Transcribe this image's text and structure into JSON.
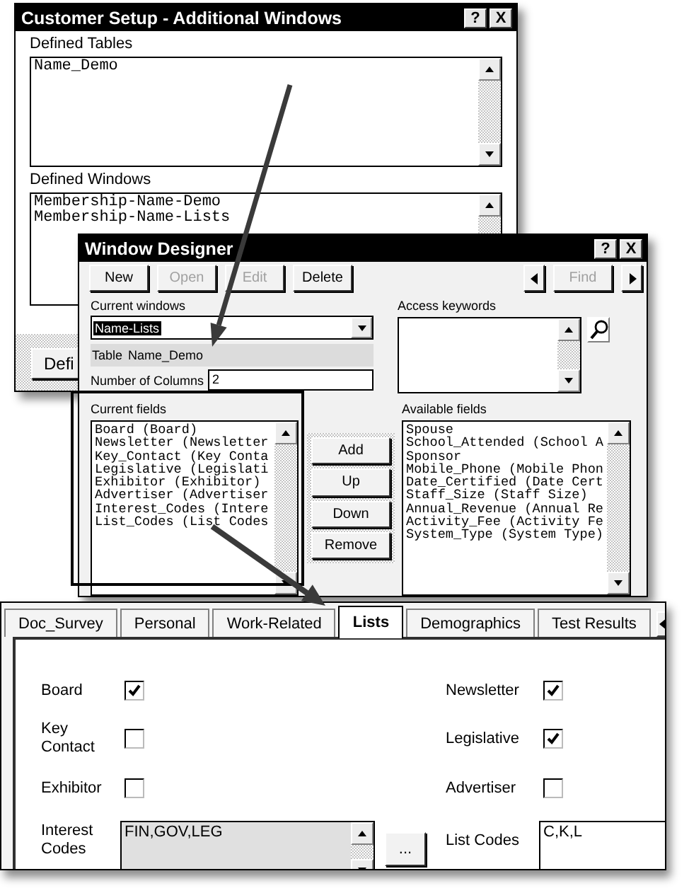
{
  "setup_window": {
    "title": "Customer Setup - Additional Windows",
    "help_button": "?",
    "close_button": "X",
    "defined_tables": {
      "label": "Defined Tables",
      "items": [
        "Name_Demo"
      ]
    },
    "defined_windows": {
      "label": "Defined Windows",
      "items": [
        "Membership-Name-Demo",
        "Membership-Name-Lists"
      ]
    },
    "partial_button": "Defi"
  },
  "designer_window": {
    "title": "Window Designer",
    "help_button": "?",
    "close_button": "X",
    "toolbar": [
      {
        "label": "New",
        "disabled": false
      },
      {
        "label": "Open",
        "disabled": true
      },
      {
        "label": "Edit",
        "disabled": true
      },
      {
        "label": "Delete",
        "disabled": false
      }
    ],
    "find_button": {
      "label": "Find",
      "disabled": true
    },
    "current_windows": {
      "label": "Current windows",
      "value": "Name-Lists"
    },
    "table": {
      "label": "Table",
      "value": "Name_Demo"
    },
    "columns": {
      "label": "Number of Columns",
      "value": "2"
    },
    "access_keywords": {
      "label": "Access keywords"
    },
    "current_fields": {
      "label": "Current fields",
      "items": [
        "Board (Board)",
        "Newsletter (Newsletter",
        "Key_Contact (Key Conta",
        "Legislative (Legislati",
        "Exhibitor (Exhibitor)",
        "Advertiser (Advertiser",
        "Interest_Codes (Intere",
        "List_Codes (List Codes"
      ]
    },
    "field_buttons": [
      "Add",
      "Up",
      "Down",
      "Remove"
    ],
    "available_fields": {
      "label": "Available fields",
      "items": [
        "Spouse",
        "School_Attended (School A",
        "Sponsor",
        "Mobile_Phone (Mobile Phon",
        "Date_Certified (Date Cert",
        "Staff_Size (Staff Size)",
        "Annual_Revenue (Annual Re",
        "Activity_Fee (Activity Fe",
        "System_Type (System Type)"
      ]
    }
  },
  "form_window": {
    "tabs": [
      {
        "label": "Doc_Survey",
        "selected": false
      },
      {
        "label": "Personal",
        "selected": false
      },
      {
        "label": "Work-Related",
        "selected": false
      },
      {
        "label": "Lists",
        "selected": true
      },
      {
        "label": "Demographics",
        "selected": false
      },
      {
        "label": "Test Results",
        "selected": false
      }
    ],
    "rows": [
      {
        "left": {
          "kind": "checkbox",
          "label": "Board",
          "checked": true
        },
        "right": {
          "kind": "checkbox",
          "label": "Newsletter",
          "checked": true
        }
      },
      {
        "left": {
          "kind": "checkbox",
          "label": "Key Contact",
          "checked": false
        },
        "right": {
          "kind": "checkbox",
          "label": "Legislative",
          "checked": true
        }
      },
      {
        "left": {
          "kind": "checkbox",
          "label": "Exhibitor",
          "checked": false
        },
        "right": {
          "kind": "checkbox",
          "label": "Advertiser",
          "checked": false
        }
      },
      {
        "left": {
          "kind": "list",
          "label": "Interest Codes",
          "value": "FIN,GOV,LEG",
          "button": "..."
        },
        "right": {
          "kind": "text",
          "label": "List Codes",
          "value": "C,K,L"
        }
      }
    ]
  }
}
